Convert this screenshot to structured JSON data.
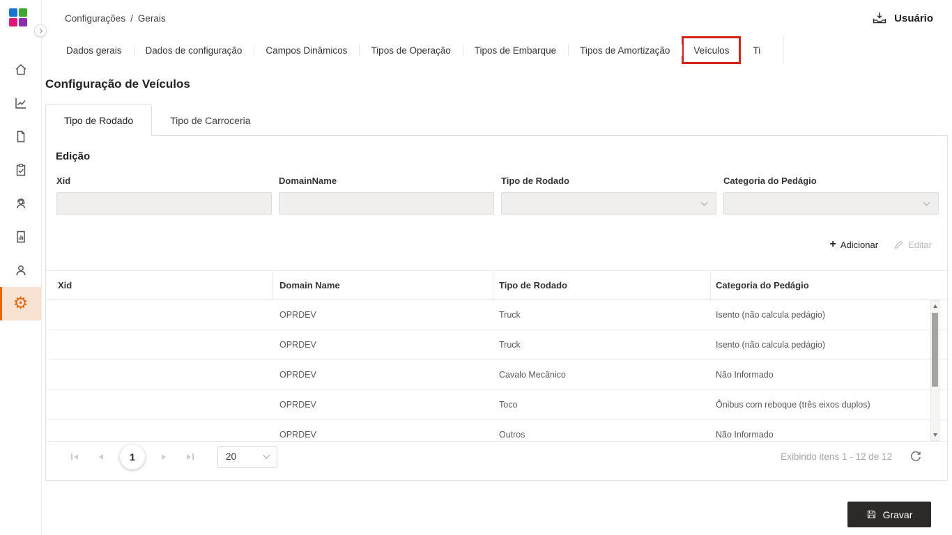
{
  "header": {
    "breadcrumb": {
      "section": "Configurações",
      "separator": "/",
      "page": "Gerais"
    },
    "user_label": "Usuário"
  },
  "sidebar": {
    "items": [
      {
        "icon": "home-icon"
      },
      {
        "icon": "analytics-icon"
      },
      {
        "icon": "document-icon"
      },
      {
        "icon": "clipboard-check-icon"
      },
      {
        "icon": "support-icon"
      },
      {
        "icon": "report-icon"
      },
      {
        "icon": "user-icon"
      },
      {
        "icon": "gear-icon",
        "active": true
      }
    ]
  },
  "tabs": {
    "items": [
      "Dados gerais",
      "Dados de configuração",
      "Campos Dinâmicos",
      "Tipos de Operação",
      "Tipos de Embarque",
      "Tipos de Amortização",
      "Veículos",
      "Ti"
    ],
    "highlighted": "Veículos"
  },
  "page": {
    "title": "Configuração de Veículos"
  },
  "subtabs": {
    "items": [
      "Tipo de Rodado",
      "Tipo de Carroceria"
    ],
    "active": "Tipo de Rodado"
  },
  "edit_form": {
    "title": "Edição",
    "fields": [
      {
        "label": "Xid",
        "type": "text",
        "value": ""
      },
      {
        "label": "DomainName",
        "type": "text",
        "value": ""
      },
      {
        "label": "Tipo de Rodado",
        "type": "select",
        "value": ""
      },
      {
        "label": "Categoria do Pedágio",
        "type": "select",
        "value": ""
      }
    ],
    "actions": {
      "add": "Adicionar",
      "edit": "Editar"
    }
  },
  "table": {
    "columns": [
      "Xid",
      "Domain Name",
      "Tipo de Rodado",
      "Categoria do Pedágio"
    ],
    "rows": [
      {
        "xid": "",
        "domain": "OPRDEV",
        "rodado": "Truck",
        "categoria": "Isento (não calcula pedágio)"
      },
      {
        "xid": "",
        "domain": "OPRDEV",
        "rodado": "Truck",
        "categoria": "Isento (não calcula pedágio)"
      },
      {
        "xid": "",
        "domain": "OPRDEV",
        "rodado": "Cavalo Mecânico",
        "categoria": "Não Informado"
      },
      {
        "xid": "",
        "domain": "OPRDEV",
        "rodado": "Toco",
        "categoria": "Ônibus com reboque (três eixos duplos)"
      },
      {
        "xid": "",
        "domain": "OPRDEV",
        "rodado": "Outros",
        "categoria": "Não Informado"
      }
    ]
  },
  "pagination": {
    "current_page": "1",
    "page_size": "20",
    "status": "Exibindo itens 1 - 12 de 12"
  },
  "footer": {
    "save_label": "Gravar"
  },
  "icons": {
    "gear": "⚙",
    "plus": "+"
  },
  "colors": {
    "accent_orange": "#e8640c",
    "accent_orange_bg": "#f8e3d3",
    "annotation_red": "#d3251c",
    "save_button_bg": "#2b2a28",
    "logo_blue": "#1b76d2",
    "logo_green": "#3fa72c",
    "logo_pink": "#e2157a",
    "logo_purple": "#8a2bb0"
  }
}
